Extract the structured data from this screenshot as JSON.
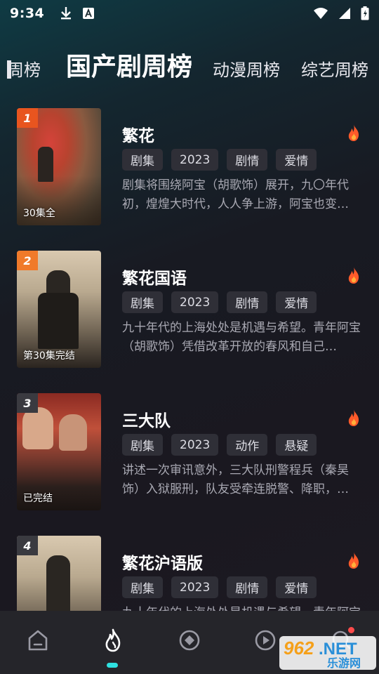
{
  "status": {
    "time": "9:34"
  },
  "tabs": {
    "left_partial": "周榜",
    "active": "国产剧周榜",
    "t2": "动漫周榜",
    "t3": "综艺周榜"
  },
  "items": [
    {
      "rank": "1",
      "title": "繁花",
      "caption": "30集全",
      "tags": [
        "剧集",
        "2023",
        "剧情",
        "爱情"
      ],
      "desc": "剧集将围绕阿宝（胡歌饰）展开，九〇年代初，煌煌大时代，人人争上游，阿宝也变…",
      "rank_color": "#e8551f"
    },
    {
      "rank": "2",
      "title": "繁花国语",
      "caption": "第30集完结",
      "tags": [
        "剧集",
        "2023",
        "剧情",
        "爱情"
      ],
      "desc": "九十年代的上海处处是机遇与希望。青年阿宝（胡歌饰）凭借改革开放的春风和自己…",
      "rank_color": "#f07a2a"
    },
    {
      "rank": "3",
      "title": "三大队",
      "caption": "已完结",
      "tags": [
        "剧集",
        "2023",
        "动作",
        "悬疑"
      ],
      "desc": "讲述一次审讯意外，三大队刑警程兵（秦昊饰）入狱服刑，队友受牵连脱警、降职，…",
      "rank_color": "#3a3a40"
    },
    {
      "rank": "4",
      "title": "繁花沪语版",
      "caption": "",
      "tags": [
        "剧集",
        "2023",
        "剧情",
        "爱情"
      ],
      "desc": "九十年代的上海处处是机遇与希望。青年阿宝（胡歌饰）凭借改革开放的春风和自己…",
      "rank_color": "#3a3a40"
    }
  ],
  "nav": {
    "items": [
      "home-icon",
      "fire-icon",
      "discover-icon",
      "play-icon",
      "search-icon"
    ],
    "accent": "#2ee0e0"
  },
  "watermark": {
    "text1": "962",
    "text2": ".NET",
    "text3": "乐游网"
  }
}
